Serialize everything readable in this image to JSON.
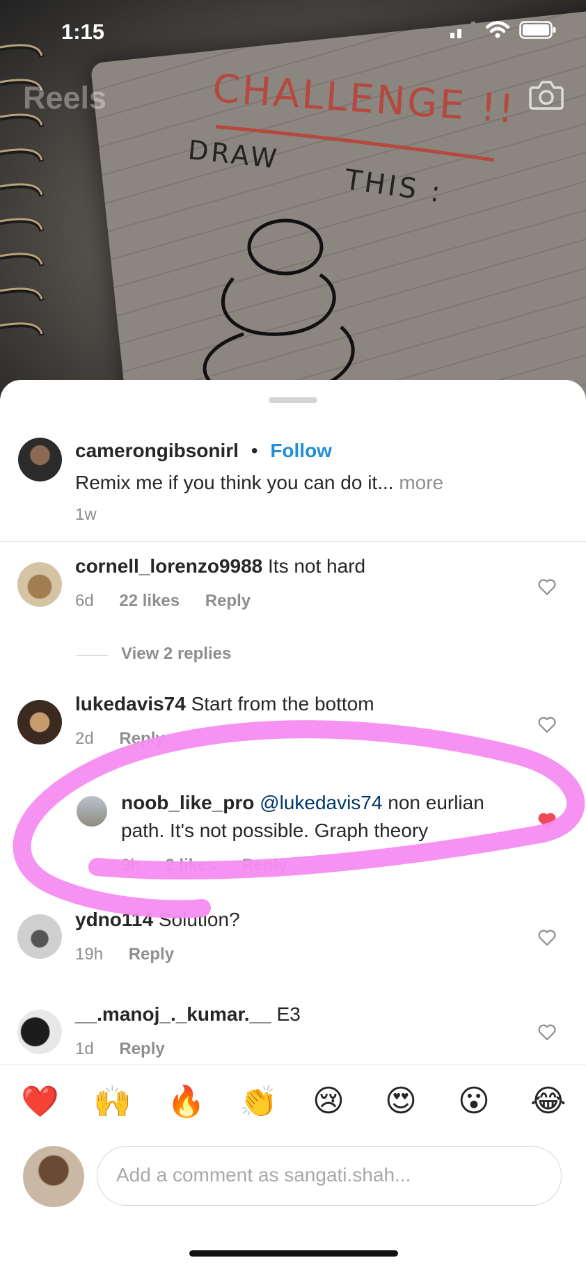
{
  "status_bar": {
    "time": "1:15"
  },
  "header": {
    "title": "Reels"
  },
  "background": {
    "caption_challenge": "CHALLENGE !!",
    "caption_draw": "DRAW",
    "caption_this": "THIS :"
  },
  "post": {
    "username": "camerongibsonirl",
    "separator": "•",
    "follow_label": "Follow",
    "caption": "Remix me if you think you can do it...",
    "more_label": "more",
    "time": "1w"
  },
  "comments": [
    {
      "username": "cornell_lorenzo9988",
      "text": "Its not hard",
      "time": "6d",
      "likes": "22 likes",
      "reply_label": "Reply",
      "liked": false
    },
    {
      "username": "lukedavis74",
      "text": "Start from the bottom",
      "time": "2d",
      "reply_label": "Reply",
      "liked": false
    },
    {
      "username": "ydno114",
      "text": "Solution?",
      "time": "19h",
      "reply_label": "Reply",
      "liked": false
    },
    {
      "username": "__.manoj_._kumar.__",
      "text": "E3",
      "time": "1d",
      "reply_label": "Reply",
      "liked": false
    }
  ],
  "view_replies": "View 2 replies",
  "reply": {
    "username": "noob_like_pro",
    "mention": "@lukedavis74",
    "text_line1": "non eurlian",
    "text_line2": "path. It's not possible. Graph theory",
    "time": "9h",
    "likes": "2 likes",
    "reply_label": "Reply",
    "liked": true
  },
  "emoji_bar": [
    "❤️",
    "🙌",
    "🔥",
    "👏",
    "😢",
    "😍",
    "😮",
    "😂"
  ],
  "composer": {
    "placeholder": "Add a comment as sangati.shah..."
  },
  "colors": {
    "follow": "#1f8fd6",
    "liked_heart": "#ed4956",
    "annotation": "#f58cf0"
  }
}
